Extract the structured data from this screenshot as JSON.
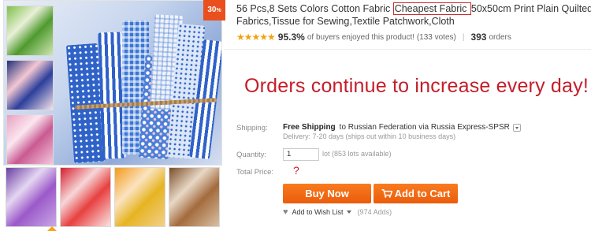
{
  "product": {
    "title_part1": "56 Pcs,8 Sets Colors Cotton Fabric ",
    "title_highlight": "Cheapest Fabric ",
    "title_part2": "50x50cm Print Plain Quilted",
    "title_line2": "Fabrics,Tissue for Sewing,Textile Patchwork,Cloth",
    "discount_badge": "30",
    "discount_badge_suffix": "%"
  },
  "rating": {
    "stars": "★★★★★",
    "star_value": 5,
    "percent": "95.3%",
    "percent_text": "of buyers enjoyed this product!",
    "votes": "(133 votes)",
    "orders_count": "393",
    "orders_label": "orders"
  },
  "promo_banner": "Orders continue to increase every day!",
  "shipping": {
    "label": "Shipping:",
    "free": "Free Shipping",
    "details": "to Russian Federation via Russia Express-SPSR",
    "delivery": "Delivery: 7-20 days (ships out within 10 business days)"
  },
  "quantity": {
    "label": "Quantity:",
    "value": "1",
    "available": "lot (853 lots available)"
  },
  "total_price": {
    "label": "Total Price:",
    "value": "?"
  },
  "buttons": {
    "buy_now": "Buy Now",
    "add_to_cart": "Add to Cart"
  },
  "wishlist": {
    "label": "Add to Wish List",
    "adds": "(974 Adds)"
  },
  "colors": {
    "accent_orange": "#ea5c0b",
    "promo_red": "#c41e2a",
    "star_gold": "#f2a20c"
  }
}
